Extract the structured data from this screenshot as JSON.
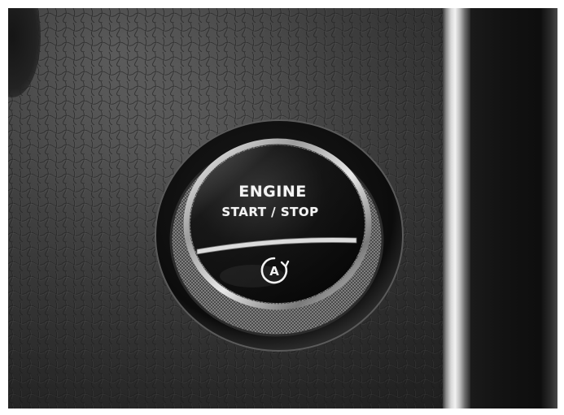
{
  "photo": {
    "subject": "engine-start-stop-button"
  },
  "button": {
    "line1": "ENGINE",
    "line2": "START / STOP",
    "auto_icon_letter": "A",
    "auto_icon": "auto-start-stop-icon"
  },
  "colors": {
    "leather": "#444444",
    "trim_chrome": "#d9d9d9",
    "button_face": "#0a0a0a",
    "knurled_ring": "#9a9a9a",
    "label_text": "#f4f4f4"
  }
}
